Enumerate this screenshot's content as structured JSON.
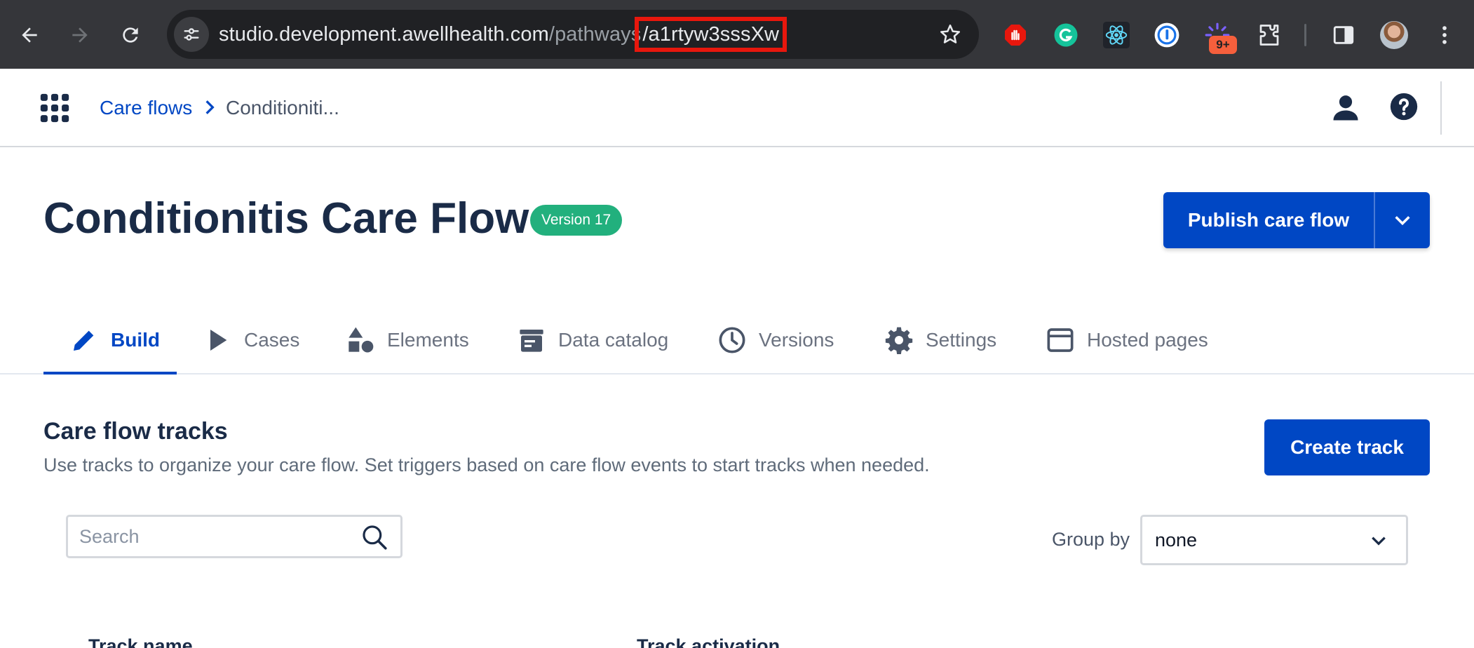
{
  "browser": {
    "url_host": "studio.development.awellhealth.com",
    "url_path": "/pathways",
    "url_highlight": "/a1rtyw3sssXw",
    "extension_badge": "9+"
  },
  "header": {
    "breadcrumb_root": "Care flows",
    "breadcrumb_current": "Conditioniti..."
  },
  "page": {
    "title": "Conditionitis Care Flow",
    "version_badge": "Version 17",
    "publish_label": "Publish care flow"
  },
  "tabs": [
    {
      "label": "Build",
      "active": true
    },
    {
      "label": "Cases"
    },
    {
      "label": "Elements"
    },
    {
      "label": "Data catalog"
    },
    {
      "label": "Versions"
    },
    {
      "label": "Settings"
    },
    {
      "label": "Hosted pages"
    }
  ],
  "tracks": {
    "title": "Care flow tracks",
    "description": "Use tracks to organize your care flow. Set triggers based on care flow events to start tracks when needed.",
    "create_label": "Create track",
    "search_placeholder": "Search",
    "group_by_label": "Group by",
    "group_by_value": "none",
    "columns": [
      "Track name",
      "Track activation"
    ]
  },
  "colors": {
    "primary": "#0047c4",
    "version_badge": "#22b07d",
    "url_highlight_box": "#e8170d"
  }
}
